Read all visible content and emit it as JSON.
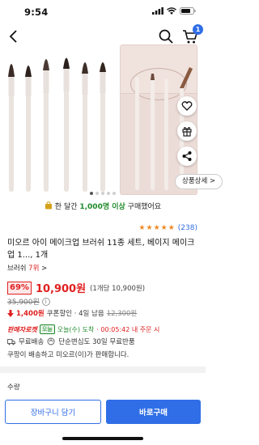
{
  "status_bar": {
    "time": "9:54"
  },
  "header": {
    "cart_count": "1"
  },
  "gallery": {
    "detail_label": "상품상세 >",
    "page_count": 5,
    "active_page": 1
  },
  "purchase_info": {
    "prefix": "한 달간 ",
    "count": "1,000명 이상",
    "suffix": " 구매했어요"
  },
  "rating": {
    "stars": 5,
    "count": "(238)"
  },
  "product": {
    "title": "미오르 아이 메이크업 브러쉬 11종 세트, 베이지 메이크업 1..., 1개",
    "category": "브러쉬 7위",
    "category_prefix": "브러쉬 ",
    "category_rank": "7위",
    "category_chevron": ">"
  },
  "price": {
    "discount": "69%",
    "sale_price": "10,900원",
    "unit_price": "(1개당 10,900원)",
    "original_price": "35,900원",
    "coupon_amount": "1,400원",
    "coupon_label": "쿠폰할인 · 4일 남음",
    "coupon_price": "12,300원"
  },
  "delivery": {
    "rocket_label": "판매자로켓",
    "today_badge": "오늘",
    "arrival": "오늘(수) 도착",
    "deadline": " · 00:05:42 내 주문 시"
  },
  "shipping": {
    "free_shipping": "무료배송",
    "return_policy": "단순변심도 30일 무료반품"
  },
  "seller": {
    "text": "쿠팡이 배송하고 미오르(이)가 판매합니다."
  },
  "quantity": {
    "label": "수량"
  },
  "actions": {
    "cart_label": "장바구니 담기",
    "buy_label": "바로구매"
  },
  "colors": {
    "accent": "#2f6ee6",
    "price_red": "#e02020",
    "green": "#1f8a2b"
  }
}
